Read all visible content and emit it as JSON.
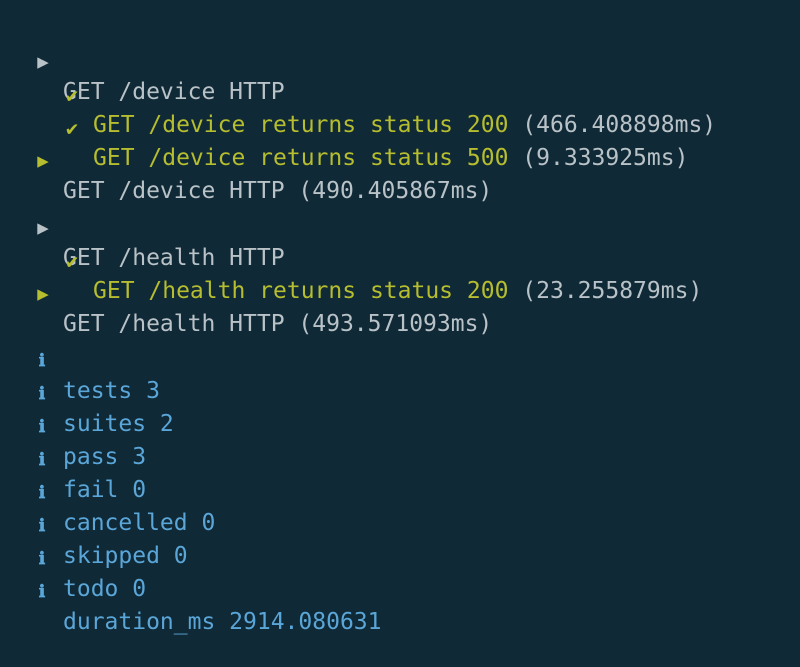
{
  "colors": {
    "background": "#0f2936",
    "text_gray": "#b9c2c7",
    "pass_olive": "#b6bd2e",
    "info_blue": "#5ba6d8"
  },
  "icons": {
    "suite_start": "triangle-right-icon",
    "suite_end": "triangle-right-icon",
    "test_pass": "check-icon",
    "info": "info-icon"
  },
  "glyphs": {
    "triangle": "▶",
    "check": "✔",
    "info": "ℹ"
  },
  "output": {
    "suites": [
      {
        "start_label": "GET /device HTTP",
        "tests": [
          {
            "name": "GET /device returns status 200",
            "duration": "(466.408898ms)"
          },
          {
            "name": "GET /device returns status 500",
            "duration": "(9.333925ms)"
          }
        ],
        "end_label": "GET /device HTTP",
        "end_duration": "(490.405867ms)"
      },
      {
        "start_label": "GET /health HTTP",
        "tests": [
          {
            "name": "GET /health returns status 200",
            "duration": "(23.255879ms)"
          }
        ],
        "end_label": "GET /health HTTP",
        "end_duration": "(493.571093ms)"
      }
    ],
    "summary": [
      "tests 3",
      "suites 2",
      "pass 3",
      "fail 0",
      "cancelled 0",
      "skipped 0",
      "todo 0",
      "duration_ms 2914.080631"
    ]
  }
}
